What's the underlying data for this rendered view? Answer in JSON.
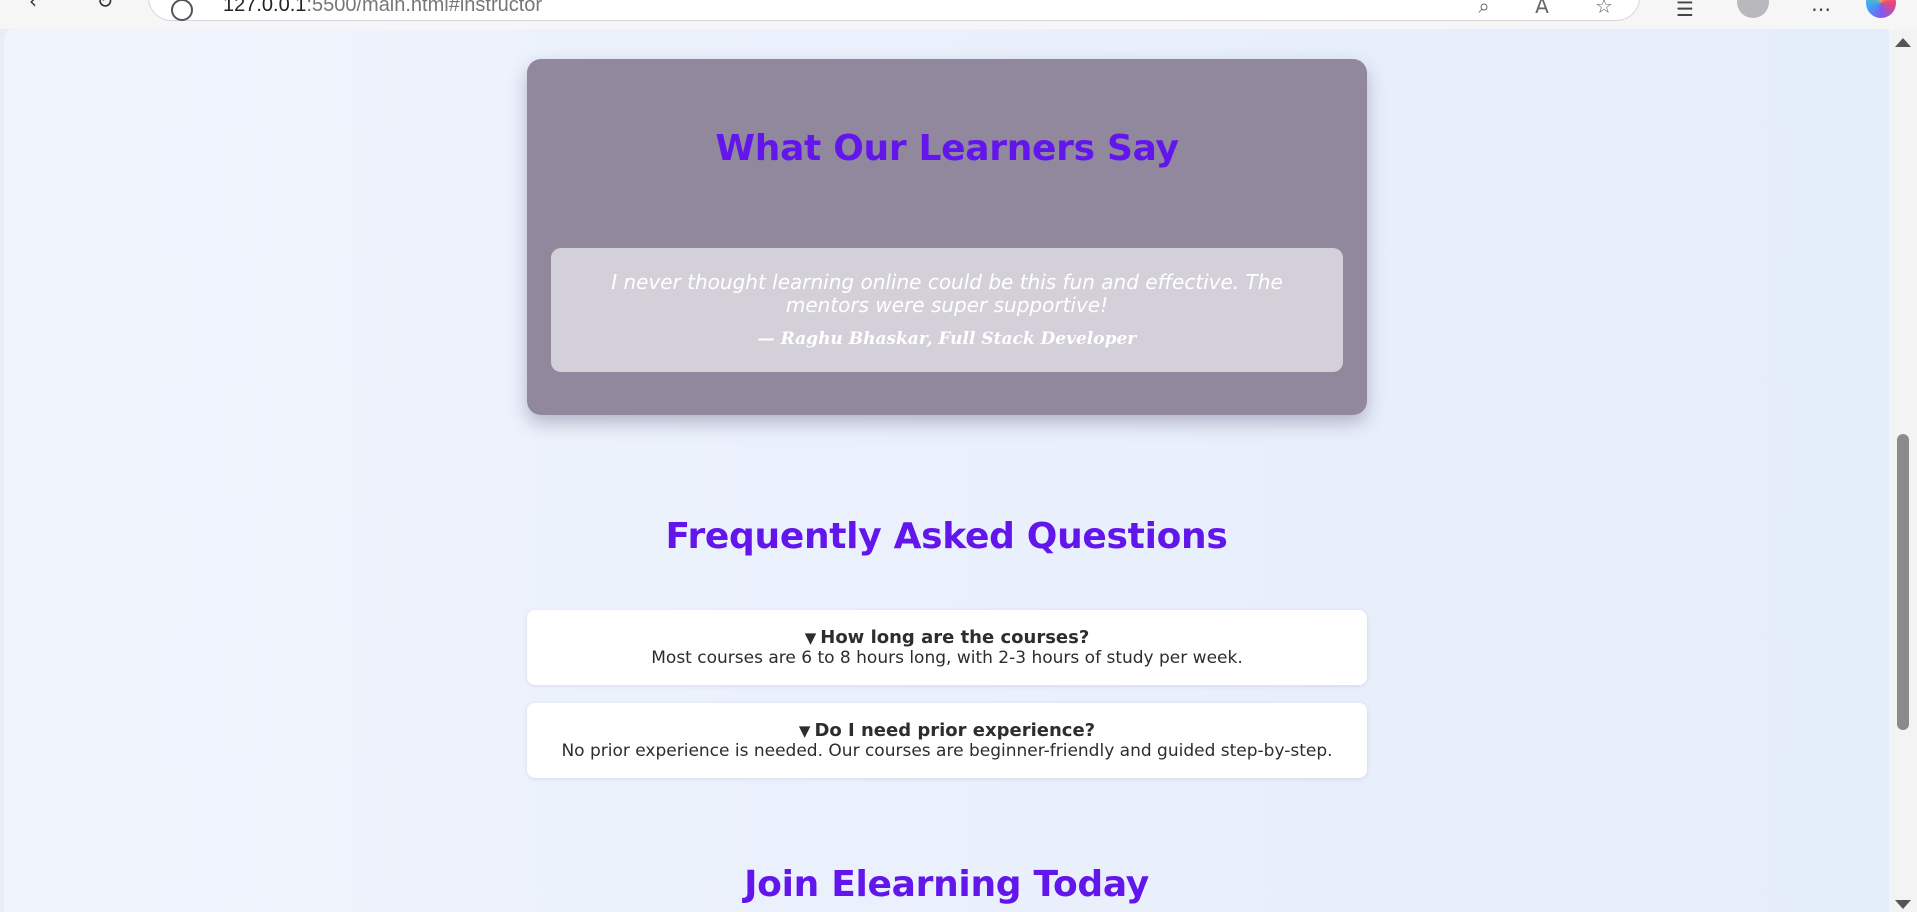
{
  "browser": {
    "url_host": "127.0.0.1",
    "url_rest": ":5500/main.html#instructor"
  },
  "testimonials": {
    "heading": "What Our Learners Say",
    "quote": "I never thought learning online could be this fun and effective. The mentors were super supportive!",
    "author": "— Raghu Bhaskar, Full Stack Developer"
  },
  "faq": {
    "heading": "Frequently Asked Questions",
    "caret": "▼",
    "items": [
      {
        "question": "How long are the courses?",
        "answer": "Most courses are 6 to 8 hours long, with 2-3 hours of study per week."
      },
      {
        "question": "Do I need prior experience?",
        "answer": "No prior experience is needed. Our courses are beginner-friendly and guided step-by-step."
      }
    ]
  },
  "join": {
    "heading": "Join Elearning Today"
  },
  "colors": {
    "heading": "#6316ec",
    "card_bg": "#91889e",
    "quote_bg": "#d3d0d9"
  }
}
